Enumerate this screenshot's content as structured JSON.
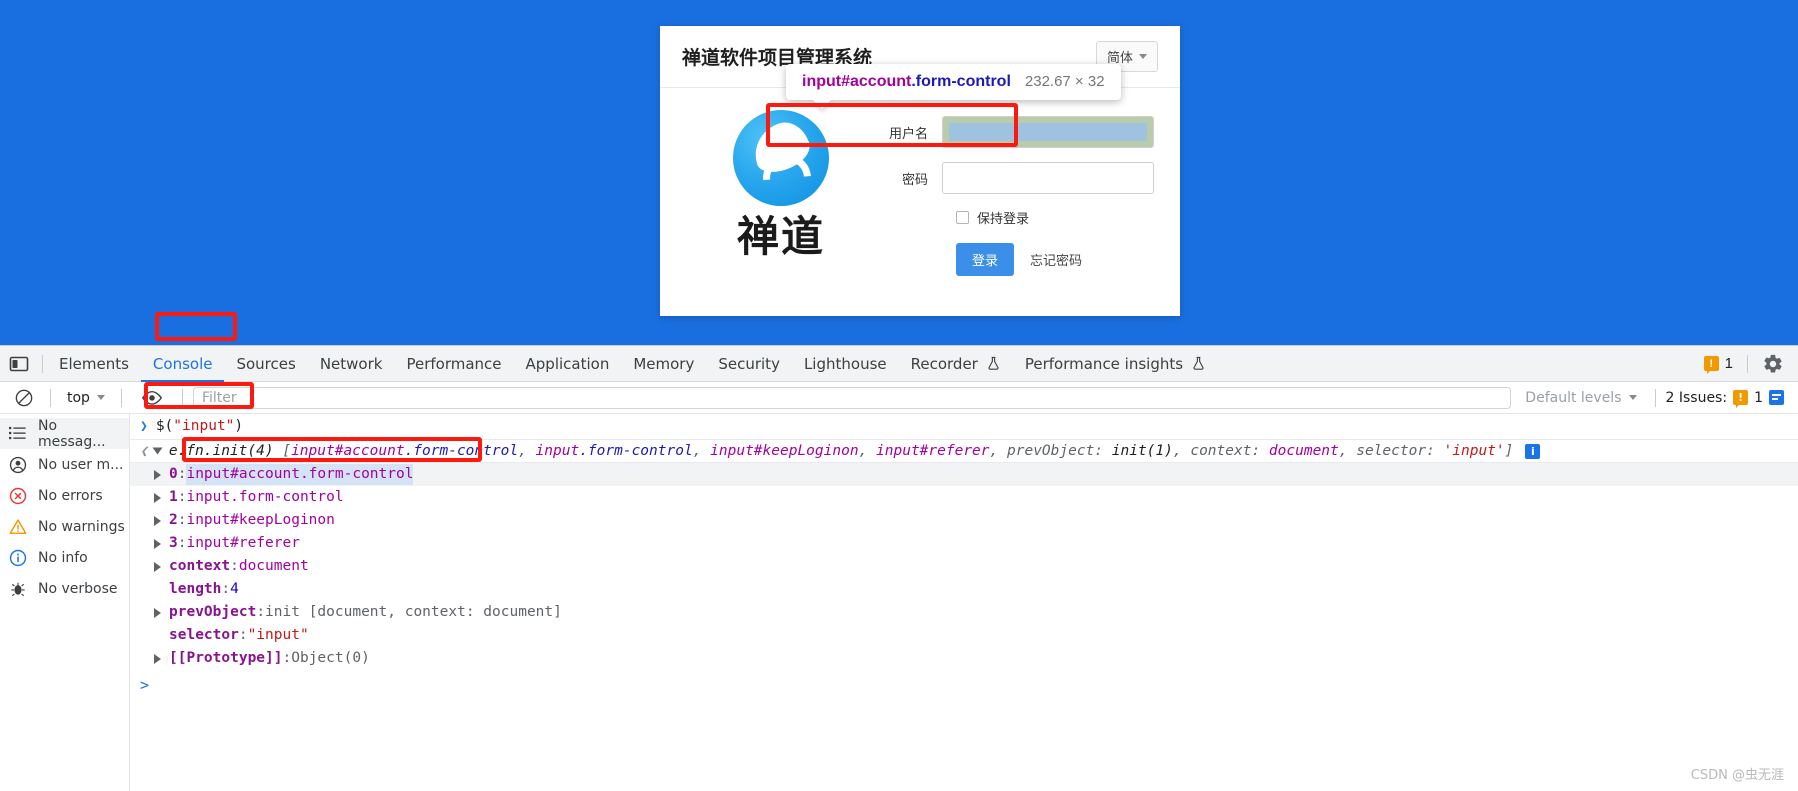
{
  "page": {
    "login": {
      "title": "禅道软件项目管理系统",
      "lang_label": "简体",
      "logo_word": "禅道",
      "account_label": "用户名",
      "account_value": "",
      "password_label": "密码",
      "password_value": "",
      "keep_login_label": "保持登录",
      "login_button": "登录",
      "forgot_link": "忘记密码"
    },
    "inspector_tooltip": {
      "tag_selector": "input#account",
      "class_selector": ".form-control",
      "dimensions": "232.67 × 32",
      "highlight_content_color": "#9ec2e0",
      "highlight_padding_color": "#b9ccaa"
    },
    "annotation_color": "#fc1a10"
  },
  "devtools": {
    "tabs": [
      {
        "label": "Elements",
        "active": false,
        "experimental": false
      },
      {
        "label": "Console",
        "active": true,
        "experimental": false
      },
      {
        "label": "Sources",
        "active": false,
        "experimental": false
      },
      {
        "label": "Network",
        "active": false,
        "experimental": false
      },
      {
        "label": "Performance",
        "active": false,
        "experimental": false
      },
      {
        "label": "Application",
        "active": false,
        "experimental": false
      },
      {
        "label": "Memory",
        "active": false,
        "experimental": false
      },
      {
        "label": "Security",
        "active": false,
        "experimental": false
      },
      {
        "label": "Lighthouse",
        "active": false,
        "experimental": false
      },
      {
        "label": "Recorder",
        "active": false,
        "experimental": true
      },
      {
        "label": "Performance insights",
        "active": false,
        "experimental": true
      }
    ],
    "tabbar_right": {
      "warning_count": "1",
      "settings_icon": "gear-icon",
      "dock_icon": "dock-side-icon"
    },
    "console_toolbar": {
      "clear_icon": "clear-console-icon",
      "context": "top",
      "eye_icon": "live-expression-icon",
      "filter_placeholder": "Filter",
      "filter_value": "",
      "levels": "Default levels",
      "issues_label": "2 Issues:",
      "issues_warning_count": "1"
    },
    "sidebar": [
      {
        "label": "No messag...",
        "icon": "list-icon",
        "selected": true
      },
      {
        "label": "No user m...",
        "icon": "user-icon",
        "selected": false
      },
      {
        "label": "No errors",
        "icon": "error-icon",
        "selected": false
      },
      {
        "label": "No warnings",
        "icon": "warning-icon",
        "selected": false
      },
      {
        "label": "No info",
        "icon": "info-icon",
        "selected": false
      },
      {
        "label": "No verbose",
        "icon": "bug-icon",
        "selected": false
      }
    ],
    "console": {
      "command": "$(\"input\")",
      "command_fn": "$(",
      "command_arg": "\"input\"",
      "command_close": ")",
      "result_header": {
        "fn": "e.fn.init(4)",
        "items": "[input#account.form-control, input.form-control, input#keepLoginon, input#referer, prevObject: init(1), context: document, selector: 'input']",
        "parts": [
          {
            "text": "e.fn.init(4) ",
            "style": "plain"
          },
          {
            "text": "[",
            "style": "grey"
          },
          {
            "text": "input#account",
            "style": "sel"
          },
          {
            "text": ".form-control",
            "style": "tag"
          },
          {
            "text": ", ",
            "style": "grey"
          },
          {
            "text": "input",
            "style": "sel"
          },
          {
            "text": ".form-control",
            "style": "tag"
          },
          {
            "text": ", ",
            "style": "grey"
          },
          {
            "text": "input#keepLoginon",
            "style": "sel"
          },
          {
            "text": ", ",
            "style": "grey"
          },
          {
            "text": "input#referer",
            "style": "sel"
          },
          {
            "text": ", ",
            "style": "grey"
          },
          {
            "text": "prevObject: ",
            "style": "grey"
          },
          {
            "text": "init(1)",
            "style": "plain"
          },
          {
            "text": ", ",
            "style": "grey"
          },
          {
            "text": "context: ",
            "style": "grey"
          },
          {
            "text": "document",
            "style": "sel"
          },
          {
            "text": ", ",
            "style": "grey"
          },
          {
            "text": "selector: ",
            "style": "grey"
          },
          {
            "text": "'input'",
            "style": "str"
          },
          {
            "text": "]",
            "style": "grey"
          }
        ]
      },
      "properties": [
        {
          "key": "0",
          "sep": ": ",
          "value": "input#account.form-control",
          "expandable": true,
          "highlighted": true,
          "value_style": "element"
        },
        {
          "key": "1",
          "sep": ": ",
          "value": "input.form-control",
          "expandable": true,
          "highlighted": false,
          "value_style": "element"
        },
        {
          "key": "2",
          "sep": ": ",
          "value": "input#keepLoginon",
          "expandable": true,
          "highlighted": false,
          "value_style": "element"
        },
        {
          "key": "3",
          "sep": ": ",
          "value": "input#referer",
          "expandable": true,
          "highlighted": false,
          "value_style": "element"
        },
        {
          "key": "context",
          "sep": ": ",
          "value": "document",
          "expandable": true,
          "highlighted": false,
          "value_style": "element"
        },
        {
          "key": "length",
          "sep": ": ",
          "value": "4",
          "expandable": false,
          "highlighted": false,
          "value_style": "number"
        },
        {
          "key": "prevObject",
          "sep": ": ",
          "value": "init [document, context: document]",
          "expandable": true,
          "highlighted": false,
          "value_style": "object"
        },
        {
          "key": "selector",
          "sep": ": ",
          "value": "\"input\"",
          "expandable": false,
          "highlighted": false,
          "value_style": "string"
        },
        {
          "key": "[[Prototype]]",
          "sep": ": ",
          "value": "Object(0)",
          "expandable": true,
          "highlighted": false,
          "value_style": "proto"
        }
      ],
      "prompt": ">"
    }
  },
  "watermark": "CSDN @虫无涯"
}
